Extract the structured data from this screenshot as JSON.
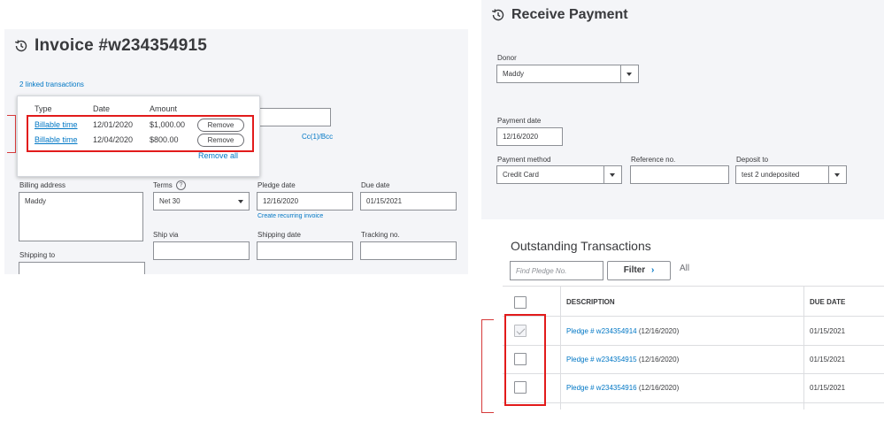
{
  "invoice": {
    "title": "Invoice #w234354915",
    "linked_label": "2 linked transactions",
    "popup": {
      "col_type": "Type",
      "col_date": "Date",
      "col_amount": "Amount",
      "rows": [
        {
          "type": "Billable time",
          "date": "12/01/2020",
          "amount": "$1,000.00",
          "action": "Remove"
        },
        {
          "type": "Billable time",
          "date": "12/04/2020",
          "amount": "$800.00",
          "action": "Remove"
        }
      ],
      "remove_all": "Remove all"
    },
    "cc_bcc": "Cc(1)/Bcc",
    "billing_address_label": "Billing address",
    "billing_address_value": "Maddy",
    "terms_label": "Terms",
    "terms_value": "Net 30",
    "pledge_date_label": "Pledge date",
    "pledge_date_value": "12/16/2020",
    "create_recurring": "Create recurring invoice",
    "due_date_label": "Due date",
    "due_date_value": "01/15/2021",
    "ship_via_label": "Ship via",
    "shipping_date_label": "Shipping date",
    "tracking_label": "Tracking no.",
    "shipping_to_label": "Shipping to",
    "help_icon": "?"
  },
  "receive_payment": {
    "title": "Receive Payment",
    "donor_label": "Donor",
    "donor_value": "Maddy",
    "payment_date_label": "Payment date",
    "payment_date_value": "12/16/2020",
    "payment_method_label": "Payment method",
    "payment_method_value": "Credit Card",
    "reference_label": "Reference no.",
    "reference_value": "",
    "deposit_label": "Deposit to",
    "deposit_value": "test 2 undeposited"
  },
  "outstanding": {
    "title": "Outstanding Transactions",
    "search_placeholder": "Find Pledge No.",
    "filter_label": "Filter",
    "filter_arrow": "›",
    "all_label": "All",
    "col_description": "DESCRIPTION",
    "col_due_date": "DUE DATE",
    "rows": [
      {
        "pledge": "Pledge # w234354914",
        "date": "(12/16/2020)",
        "due": "01/15/2021",
        "checked": true
      },
      {
        "pledge": "Pledge # w234354915",
        "date": "(12/16/2020)",
        "due": "01/15/2021",
        "checked": false
      },
      {
        "pledge": "Pledge # w234354916",
        "date": "(12/16/2020)",
        "due": "01/15/2021",
        "checked": false
      }
    ]
  },
  "colors": {
    "link": "#0077c5",
    "highlight": "#e21b1b",
    "panel_bg": "#f4f5f8"
  }
}
